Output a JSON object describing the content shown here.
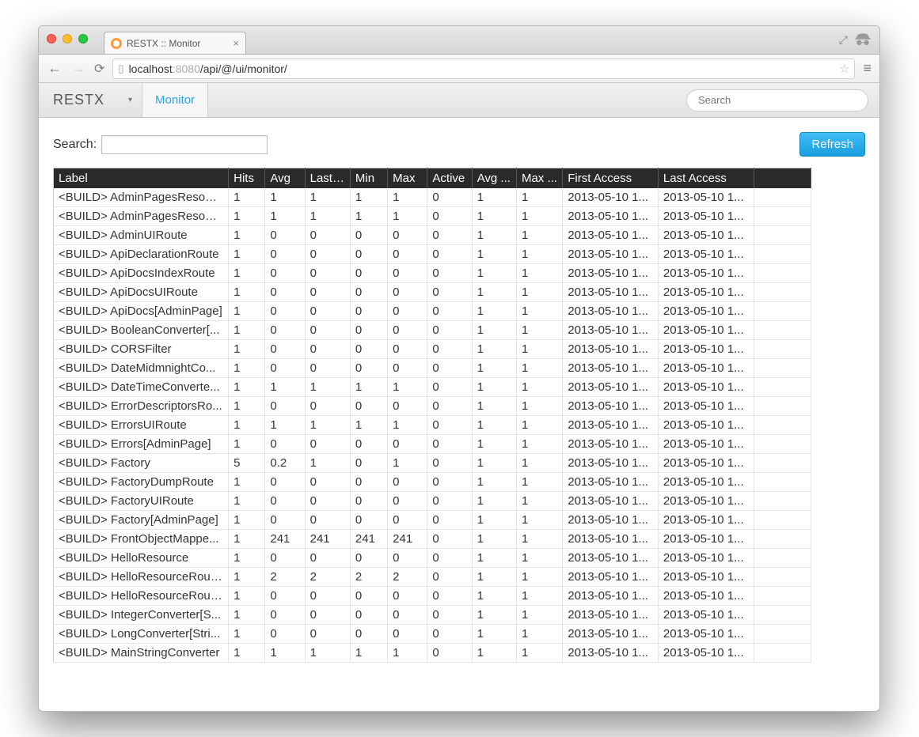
{
  "browser": {
    "tab_title": "RESTX :: Monitor",
    "url_host": "localhost",
    "url_port": ":8080",
    "url_path": "/api/@/ui/monitor/"
  },
  "header": {
    "brand": "RESTX",
    "nav_item": "Monitor",
    "search_placeholder": "Search"
  },
  "toolbar": {
    "search_label": "Search:",
    "refresh_label": "Refresh"
  },
  "columns": [
    "Label",
    "Hits",
    "Avg",
    "Last ...",
    "Min",
    "Max",
    "Active",
    "Avg ...",
    "Max ...",
    "First Access",
    "Last Access",
    ""
  ],
  "rows": [
    {
      "label": "<BUILD> AdminPagesResource",
      "hits": "1",
      "avg": "1",
      "last": "1",
      "min": "1",
      "max": "1",
      "active": "0",
      "avga": "1",
      "maxa": "1",
      "first": "2013-05-10 1...",
      "lastacc": "2013-05-10 1..."
    },
    {
      "label": "<BUILD> AdminPagesResour...",
      "hits": "1",
      "avg": "1",
      "last": "1",
      "min": "1",
      "max": "1",
      "active": "0",
      "avga": "1",
      "maxa": "1",
      "first": "2013-05-10 1...",
      "lastacc": "2013-05-10 1..."
    },
    {
      "label": "<BUILD> AdminUIRoute",
      "hits": "1",
      "avg": "0",
      "last": "0",
      "min": "0",
      "max": "0",
      "active": "0",
      "avga": "1",
      "maxa": "1",
      "first": "2013-05-10 1...",
      "lastacc": "2013-05-10 1..."
    },
    {
      "label": "<BUILD> ApiDeclarationRoute",
      "hits": "1",
      "avg": "0",
      "last": "0",
      "min": "0",
      "max": "0",
      "active": "0",
      "avga": "1",
      "maxa": "1",
      "first": "2013-05-10 1...",
      "lastacc": "2013-05-10 1..."
    },
    {
      "label": "<BUILD> ApiDocsIndexRoute",
      "hits": "1",
      "avg": "0",
      "last": "0",
      "min": "0",
      "max": "0",
      "active": "0",
      "avga": "1",
      "maxa": "1",
      "first": "2013-05-10 1...",
      "lastacc": "2013-05-10 1..."
    },
    {
      "label": "<BUILD> ApiDocsUIRoute",
      "hits": "1",
      "avg": "0",
      "last": "0",
      "min": "0",
      "max": "0",
      "active": "0",
      "avga": "1",
      "maxa": "1",
      "first": "2013-05-10 1...",
      "lastacc": "2013-05-10 1..."
    },
    {
      "label": "<BUILD> ApiDocs[AdminPage]",
      "hits": "1",
      "avg": "0",
      "last": "0",
      "min": "0",
      "max": "0",
      "active": "0",
      "avga": "1",
      "maxa": "1",
      "first": "2013-05-10 1...",
      "lastacc": "2013-05-10 1..."
    },
    {
      "label": "<BUILD> BooleanConverter[...",
      "hits": "1",
      "avg": "0",
      "last": "0",
      "min": "0",
      "max": "0",
      "active": "0",
      "avga": "1",
      "maxa": "1",
      "first": "2013-05-10 1...",
      "lastacc": "2013-05-10 1..."
    },
    {
      "label": "<BUILD> CORSFilter",
      "hits": "1",
      "avg": "0",
      "last": "0",
      "min": "0",
      "max": "0",
      "active": "0",
      "avga": "1",
      "maxa": "1",
      "first": "2013-05-10 1...",
      "lastacc": "2013-05-10 1..."
    },
    {
      "label": "<BUILD> DateMidmnightCo...",
      "hits": "1",
      "avg": "0",
      "last": "0",
      "min": "0",
      "max": "0",
      "active": "0",
      "avga": "1",
      "maxa": "1",
      "first": "2013-05-10 1...",
      "lastacc": "2013-05-10 1..."
    },
    {
      "label": "<BUILD> DateTimeConverte...",
      "hits": "1",
      "avg": "1",
      "last": "1",
      "min": "1",
      "max": "1",
      "active": "0",
      "avga": "1",
      "maxa": "1",
      "first": "2013-05-10 1...",
      "lastacc": "2013-05-10 1..."
    },
    {
      "label": "<BUILD> ErrorDescriptorsRo...",
      "hits": "1",
      "avg": "0",
      "last": "0",
      "min": "0",
      "max": "0",
      "active": "0",
      "avga": "1",
      "maxa": "1",
      "first": "2013-05-10 1...",
      "lastacc": "2013-05-10 1..."
    },
    {
      "label": "<BUILD> ErrorsUIRoute",
      "hits": "1",
      "avg": "1",
      "last": "1",
      "min": "1",
      "max": "1",
      "active": "0",
      "avga": "1",
      "maxa": "1",
      "first": "2013-05-10 1...",
      "lastacc": "2013-05-10 1..."
    },
    {
      "label": "<BUILD> Errors[AdminPage]",
      "hits": "1",
      "avg": "0",
      "last": "0",
      "min": "0",
      "max": "0",
      "active": "0",
      "avga": "1",
      "maxa": "1",
      "first": "2013-05-10 1...",
      "lastacc": "2013-05-10 1..."
    },
    {
      "label": "<BUILD> Factory",
      "hits": "5",
      "avg": "0.2",
      "last": "1",
      "min": "0",
      "max": "1",
      "active": "0",
      "avga": "1",
      "maxa": "1",
      "first": "2013-05-10 1...",
      "lastacc": "2013-05-10 1..."
    },
    {
      "label": "<BUILD> FactoryDumpRoute",
      "hits": "1",
      "avg": "0",
      "last": "0",
      "min": "0",
      "max": "0",
      "active": "0",
      "avga": "1",
      "maxa": "1",
      "first": "2013-05-10 1...",
      "lastacc": "2013-05-10 1..."
    },
    {
      "label": "<BUILD> FactoryUIRoute",
      "hits": "1",
      "avg": "0",
      "last": "0",
      "min": "0",
      "max": "0",
      "active": "0",
      "avga": "1",
      "maxa": "1",
      "first": "2013-05-10 1...",
      "lastacc": "2013-05-10 1..."
    },
    {
      "label": "<BUILD> Factory[AdminPage]",
      "hits": "1",
      "avg": "0",
      "last": "0",
      "min": "0",
      "max": "0",
      "active": "0",
      "avga": "1",
      "maxa": "1",
      "first": "2013-05-10 1...",
      "lastacc": "2013-05-10 1..."
    },
    {
      "label": "<BUILD> FrontObjectMappe...",
      "hits": "1",
      "avg": "241",
      "last": "241",
      "min": "241",
      "max": "241",
      "active": "0",
      "avga": "1",
      "maxa": "1",
      "first": "2013-05-10 1...",
      "lastacc": "2013-05-10 1..."
    },
    {
      "label": "<BUILD> HelloResource",
      "hits": "1",
      "avg": "0",
      "last": "0",
      "min": "0",
      "max": "0",
      "active": "0",
      "avga": "1",
      "maxa": "1",
      "first": "2013-05-10 1...",
      "lastacc": "2013-05-10 1..."
    },
    {
      "label": "<BUILD> HelloResourceRouter",
      "hits": "1",
      "avg": "2",
      "last": "2",
      "min": "2",
      "max": "2",
      "active": "0",
      "avga": "1",
      "maxa": "1",
      "first": "2013-05-10 1...",
      "lastacc": "2013-05-10 1..."
    },
    {
      "label": "<BUILD> HelloResourceRout...",
      "hits": "1",
      "avg": "0",
      "last": "0",
      "min": "0",
      "max": "0",
      "active": "0",
      "avga": "1",
      "maxa": "1",
      "first": "2013-05-10 1...",
      "lastacc": "2013-05-10 1..."
    },
    {
      "label": "<BUILD> IntegerConverter[S...",
      "hits": "1",
      "avg": "0",
      "last": "0",
      "min": "0",
      "max": "0",
      "active": "0",
      "avga": "1",
      "maxa": "1",
      "first": "2013-05-10 1...",
      "lastacc": "2013-05-10 1..."
    },
    {
      "label": "<BUILD> LongConverter[Stri...",
      "hits": "1",
      "avg": "0",
      "last": "0",
      "min": "0",
      "max": "0",
      "active": "0",
      "avga": "1",
      "maxa": "1",
      "first": "2013-05-10 1...",
      "lastacc": "2013-05-10 1..."
    },
    {
      "label": "<BUILD> MainStringConverter",
      "hits": "1",
      "avg": "1",
      "last": "1",
      "min": "1",
      "max": "1",
      "active": "0",
      "avga": "1",
      "maxa": "1",
      "first": "2013-05-10 1...",
      "lastacc": "2013-05-10 1..."
    }
  ]
}
